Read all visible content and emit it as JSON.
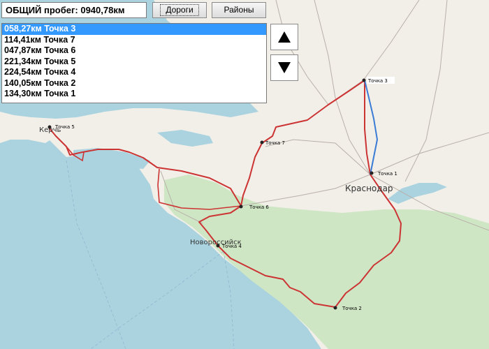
{
  "summary": {
    "total_mileage": "ОБЩИЙ пробег: 0940,78км"
  },
  "buttons": {
    "roads": "Дороги",
    "districts": "Районы"
  },
  "point_list": {
    "items": [
      {
        "label": "058,27км Точка 3",
        "selected": true
      },
      {
        "label": "114,41км Точка 7",
        "selected": false
      },
      {
        "label": "047,87км Точка 6",
        "selected": false
      },
      {
        "label": "221,34км Точка 5",
        "selected": false
      },
      {
        "label": "224,54км Точка 4",
        "selected": false
      },
      {
        "label": "140,05км Точка 2",
        "selected": false
      },
      {
        "label": "134,30км Точка 1",
        "selected": false
      }
    ]
  },
  "controls": {
    "move_up": "up-arrow-icon",
    "move_down": "down-arrow-icon"
  },
  "map": {
    "city_labels": {
      "krasnodar": "Краснодар",
      "novorossiysk": "Новороссийск",
      "kerch": "Керчь"
    },
    "points": {
      "p1": "Точка 1",
      "p2": "Точка 2",
      "p3": "Точка 3",
      "p4": "Точка 4",
      "p5": "Точка 5",
      "p6": "Точка 6",
      "p7": "Точка 7"
    },
    "colors": {
      "route": "#cc3333",
      "segment_highlight": "#3a7bd5",
      "sea": "#aad3df",
      "land": "#f2efe9",
      "forest": "#cfe6c5"
    }
  }
}
